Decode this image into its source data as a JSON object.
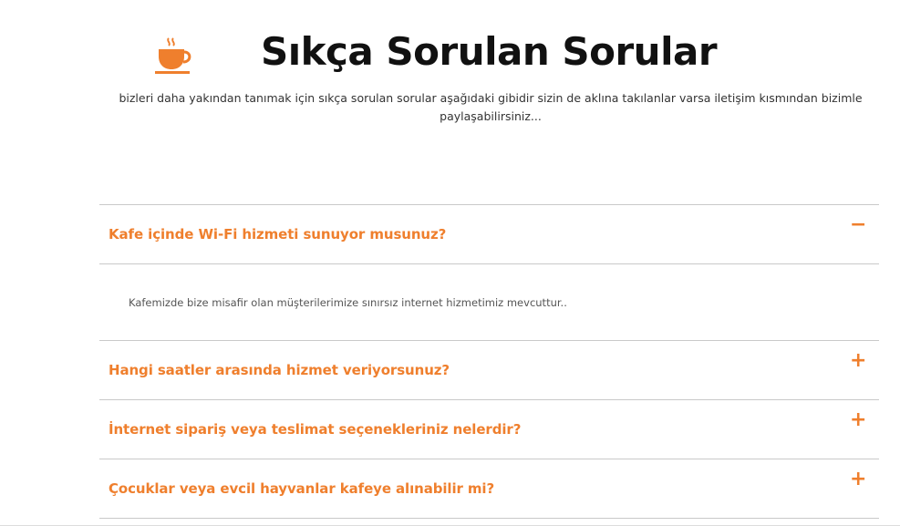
{
  "header": {
    "title": "Sıkça Sorulan Sorular",
    "subtitle": "bizleri daha yakından tanımak için sıkça sorulan sorular aşağıdaki gibidir sizin de aklına takılanlar varsa iletişim kısmından bizimle paylaşabilirsiniz...",
    "logo_icon": "coffee-cup-icon"
  },
  "colors": {
    "accent": "#ef7f2d",
    "divider": "#c9c9c9"
  },
  "faq": {
    "items": [
      {
        "question": "Kafe içinde Wi-Fi hizmeti sunuyor musunuz?",
        "expanded": true,
        "toggle": "−",
        "answer": "Kafemizde bize misafir olan müşterilerimize sınırsız internet hizmetimiz mevcuttur.."
      },
      {
        "question": "Hangi saatler arasında hizmet veriyorsunuz?",
        "expanded": false,
        "toggle": "+"
      },
      {
        "question": "İnternet sipariş veya teslimat seçenekleriniz nelerdir?",
        "expanded": false,
        "toggle": "+"
      },
      {
        "question": "Çocuklar veya evcil hayvanlar kafeye alınabilir mi?",
        "expanded": false,
        "toggle": "+"
      }
    ]
  }
}
